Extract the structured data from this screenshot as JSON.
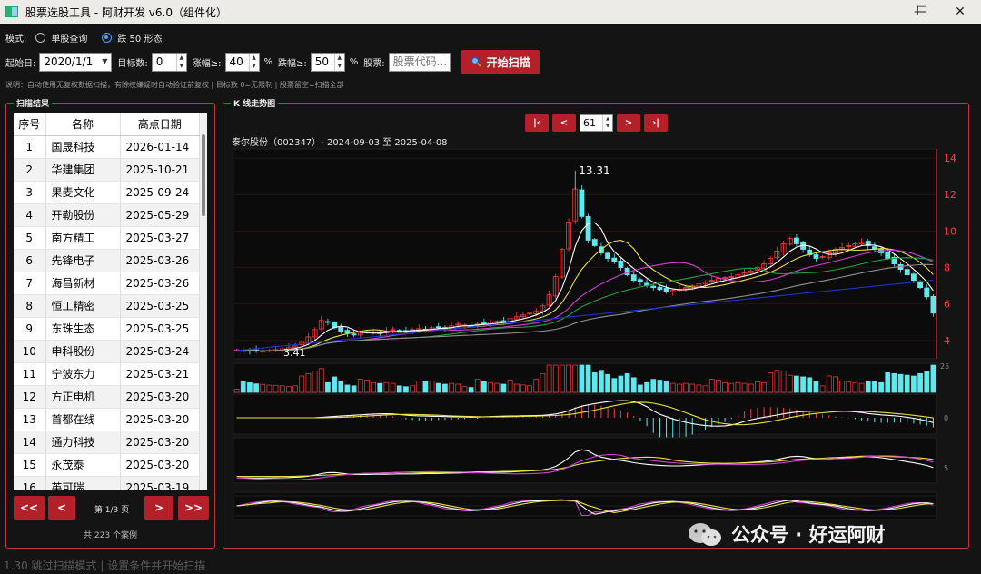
{
  "window": {
    "title": "股票选股工具 - 阿财开发 v6.0（组件化）",
    "minimize_glyph": "—",
    "maximize_glyph": "☐",
    "close_glyph": "✕"
  },
  "mode": {
    "label": "模式:",
    "options": [
      {
        "label": "单股查询",
        "selected": false
      },
      {
        "label": "跌 50 形态",
        "selected": true
      }
    ]
  },
  "params": {
    "start_label": "起始日:",
    "start_value": "2020/1/1",
    "target_label": "目标数:",
    "target_value": "0",
    "rise_label": "涨幅≥:",
    "rise_value": "40",
    "rise_unit": "%",
    "fall_label": "跌幅≥:",
    "fall_value": "50",
    "fall_unit": "%",
    "stock_label": "股票:",
    "stock_placeholder": "股票代码...",
    "scan_label": "开始扫描",
    "scan_icon": "search-icon"
  },
  "note": "说明：自动使用无复权数据扫描，有除权嫌疑时自动验证前复权 | 目标数 0=无限制 | 股票留空=扫描全部",
  "results": {
    "group_title": "扫描结果",
    "columns": [
      "序号",
      "名称",
      "高点日期"
    ],
    "rows": [
      [
        "1",
        "国晟科技",
        "2026-01-14"
      ],
      [
        "2",
        "华建集团",
        "2025-10-21"
      ],
      [
        "3",
        "果麦文化",
        "2025-09-24"
      ],
      [
        "4",
        "开勒股份",
        "2025-05-29"
      ],
      [
        "5",
        "南方精工",
        "2025-03-27"
      ],
      [
        "6",
        "先锋电子",
        "2025-03-26"
      ],
      [
        "7",
        "海昌新材",
        "2025-03-26"
      ],
      [
        "8",
        "恒工精密",
        "2025-03-25"
      ],
      [
        "9",
        "东珠生态",
        "2025-03-25"
      ],
      [
        "10",
        "申科股份",
        "2025-03-24"
      ],
      [
        "11",
        "宁波东力",
        "2025-03-21"
      ],
      [
        "12",
        "方正电机",
        "2025-03-20"
      ],
      [
        "13",
        "首都在线",
        "2025-03-20"
      ],
      [
        "14",
        "通力科技",
        "2025-03-20"
      ],
      [
        "15",
        "永茂泰",
        "2025-03-20"
      ],
      [
        "16",
        "英可瑞",
        "2025-03-19"
      ]
    ],
    "first_label": "<<",
    "prev_label": "<",
    "page_info": "第 1/3 页",
    "next_label": ">",
    "last_label": ">>",
    "total": "共 223 个案例"
  },
  "kline": {
    "group_title": "K 线走势图",
    "nav_first": "|‹",
    "nav_prev": "<",
    "index_value": "61",
    "nav_next": ">",
    "nav_last": "›|",
    "subtitle": "泰尔股份（002347）- 2024-09-03 至 2025-04-08",
    "high_label": "13.31",
    "low_label": "3.41"
  },
  "watermark": "公众号 · 好运阿财",
  "status": "1.30 跳过扫描模式 | 设置条件并开始扫描",
  "colors": {
    "accent": "#b3202a",
    "up": "#ff3b3b",
    "down": "#5ee8f0",
    "axis": "#ff3b3b"
  },
  "chart_data": {
    "type": "candlestick",
    "price_axis_ticks": [
      4,
      6,
      8,
      10,
      12,
      14
    ],
    "ylim": [
      3,
      14.5
    ],
    "macd_ticks": [
      "0"
    ],
    "osc_ticks": [
      "5"
    ],
    "close": [
      3.48,
      3.45,
      3.43,
      3.42,
      3.44,
      3.46,
      3.5,
      3.55,
      3.6,
      3.7,
      3.9,
      4.2,
      4.6,
      5.1,
      5.0,
      4.7,
      4.5,
      4.4,
      4.3,
      4.4,
      4.5,
      4.45,
      4.4,
      4.5,
      4.6,
      4.55,
      4.5,
      4.6,
      4.65,
      4.6,
      4.7,
      4.75,
      4.7,
      4.8,
      4.9,
      4.85,
      4.8,
      4.9,
      4.95,
      5.0,
      5.05,
      5.0,
      5.2,
      5.3,
      5.4,
      5.5,
      5.6,
      5.9,
      6.5,
      7.5,
      9.0,
      10.5,
      12.3,
      10.8,
      9.5,
      9.2,
      8.8,
      8.5,
      8.3,
      8.0,
      7.6,
      7.3,
      7.2,
      7.0,
      6.9,
      6.8,
      6.7,
      6.75,
      6.8,
      6.9,
      7.0,
      7.1,
      7.2,
      7.3,
      7.4,
      7.45,
      7.5,
      7.6,
      7.7,
      7.8,
      8.0,
      8.2,
      8.5,
      8.9,
      9.3,
      9.6,
      9.3,
      9.0,
      8.7,
      8.5,
      8.6,
      8.8,
      9.0,
      9.1,
      9.2,
      9.3,
      9.4,
      9.2,
      9.0,
      8.8,
      8.5,
      8.2,
      7.9,
      7.6,
      7.3,
      6.9,
      6.4,
      5.5
    ],
    "volume_top_tick": "25"
  }
}
